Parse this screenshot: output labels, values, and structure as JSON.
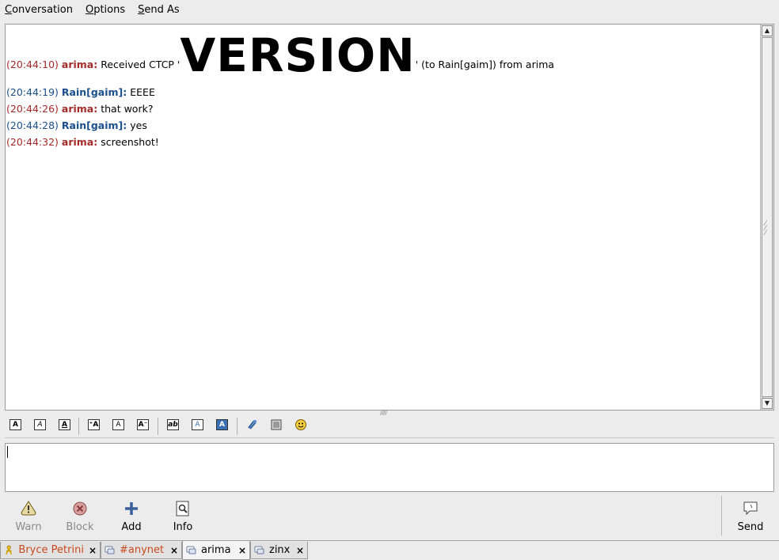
{
  "menu": {
    "items": [
      {
        "label": "Conversation",
        "accel": "C",
        "rest": "onversation"
      },
      {
        "label": "Options",
        "accel": "O",
        "rest": "ptions"
      },
      {
        "label": "Send As",
        "accel": "S",
        "rest": "end As"
      }
    ]
  },
  "history": {
    "messages": [
      {
        "time": "(20:44:10)",
        "nick": "arima:",
        "color": "red",
        "pre": "Received CTCP '",
        "big": "VERSION",
        "post": "' (to Rain[gaim]) from arima"
      },
      {
        "time": "(20:44:19)",
        "nick": "Rain[gaim]:",
        "color": "blue",
        "text": "EEEE"
      },
      {
        "time": "(20:44:26)",
        "nick": "arima:",
        "color": "red",
        "text": "that work?"
      },
      {
        "time": "(20:44:28)",
        "nick": "Rain[gaim]:",
        "color": "blue",
        "text": "yes"
      },
      {
        "time": "(20:44:32)",
        "nick": "arima:",
        "color": "red",
        "text": "screenshot!"
      }
    ]
  },
  "toolbar": {
    "buttons": [
      "bold-icon",
      "italic-icon",
      "underline-icon",
      "larger-font-icon",
      "normal-font-icon",
      "smaller-font-icon",
      "font-face-icon",
      "foreground-color-icon",
      "background-color-icon",
      "link-icon",
      "image-icon",
      "smiley-icon"
    ]
  },
  "entry": {
    "value": ""
  },
  "actions": {
    "warn": "Warn",
    "block": "Block",
    "add": "Add",
    "info": "Info",
    "send": "Send"
  },
  "tabs": [
    {
      "label": "Bryce Petrini",
      "color": "#c84a1e",
      "icon": "aim-person-icon"
    },
    {
      "label": "#anynet",
      "color": "#c84a1e",
      "icon": "irc-icon"
    },
    {
      "label": "arima",
      "color": "#000000",
      "icon": "irc-icon",
      "active": true
    },
    {
      "label": "zinx",
      "color": "#000000",
      "icon": "irc-icon"
    }
  ],
  "colors": {
    "remote_nick": "#a52a2a",
    "local_nick": "#1a4f8c",
    "unread_tab": "#c84a1e"
  }
}
